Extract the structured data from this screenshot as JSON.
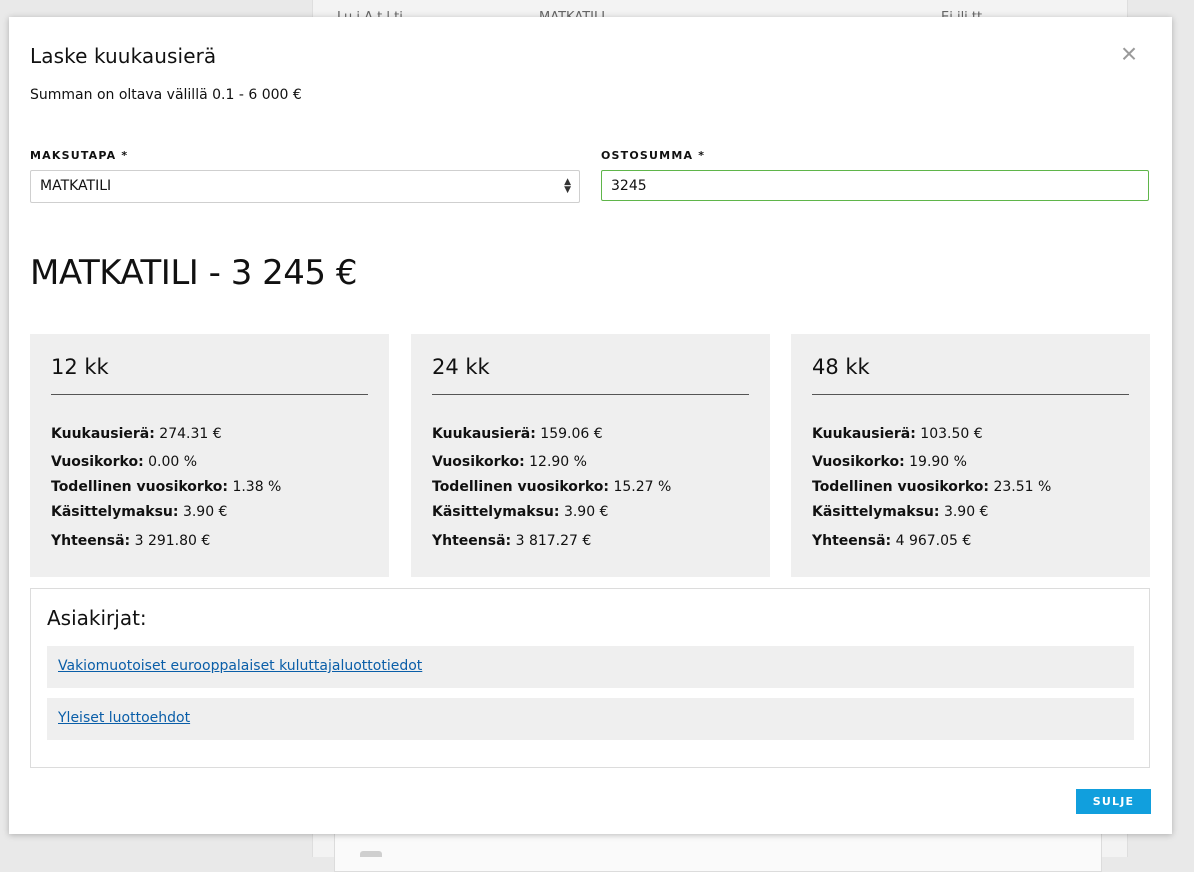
{
  "background": {
    "text_left": "Lu i A t   l ti",
    "text_mid": "MATKATILI",
    "text_right": "Ei ili  tt"
  },
  "modal": {
    "title": "Laske kuukausierä",
    "hint": "Summan on oltava välillä 0.1 - 6 000 €",
    "payment_method": {
      "label": "MAKSUTAPA *",
      "value": "MATKATILI"
    },
    "amount": {
      "label": "OSTOSUMMA *",
      "value": "3245"
    },
    "summary_heading": "MATKATILI - 3 245 €",
    "plans": [
      {
        "term": "12 kk",
        "rows": [
          {
            "label": "Kuukausierä:",
            "value": "274.31 €"
          },
          {
            "label": "Vuosikorko:",
            "value": "0.00 %"
          },
          {
            "label": "Todellinen vuosikorko:",
            "value": "1.38 %"
          },
          {
            "label": "Käsittelymaksu:",
            "value": "3.90 €"
          },
          {
            "label": "Yhteensä:",
            "value": "3 291.80 €"
          }
        ]
      },
      {
        "term": "24 kk",
        "rows": [
          {
            "label": "Kuukausierä:",
            "value": "159.06 €"
          },
          {
            "label": "Vuosikorko:",
            "value": "12.90 %"
          },
          {
            "label": "Todellinen vuosikorko:",
            "value": "15.27 %"
          },
          {
            "label": "Käsittelymaksu:",
            "value": "3.90 €"
          },
          {
            "label": "Yhteensä:",
            "value": "3 817.27 €"
          }
        ]
      },
      {
        "term": "48 kk",
        "rows": [
          {
            "label": "Kuukausierä:",
            "value": "103.50 €"
          },
          {
            "label": "Vuosikorko:",
            "value": "19.90 %"
          },
          {
            "label": "Todellinen vuosikorko:",
            "value": "23.51 %"
          },
          {
            "label": "Käsittelymaksu:",
            "value": "3.90 €"
          },
          {
            "label": "Yhteensä:",
            "value": "4 967.05 €"
          }
        ]
      }
    ],
    "documents": {
      "title": "Asiakirjat:",
      "links": [
        {
          "label": "Vakiomuotoiset eurooppalaiset kuluttajaluottotiedot"
        },
        {
          "label": "Yleiset luottoehdot"
        }
      ]
    },
    "close_button_label": "SULJE",
    "close_icon": "close-icon",
    "colors": {
      "accent": "#119fdd",
      "input_valid_border": "#5fb54a",
      "link": "#0a5ea8",
      "card_bg": "#efefef"
    }
  }
}
